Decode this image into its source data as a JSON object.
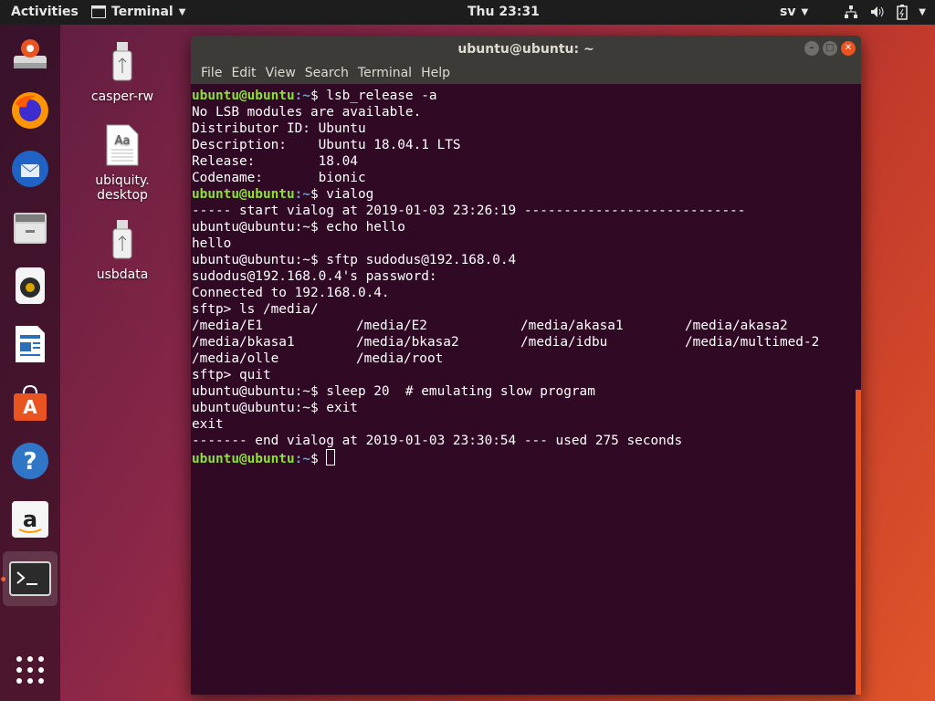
{
  "topbar": {
    "activities": "Activities",
    "app_menu": "Terminal",
    "clock": "Thu 23:31",
    "language": "sv"
  },
  "desktop": {
    "icons": [
      {
        "label": "casper-rw",
        "icon": "usb-drive-icon"
      },
      {
        "label": "ubiquity.\ndesktop",
        "icon": "text-file-icon"
      },
      {
        "label": "usbdata",
        "icon": "usb-drive-icon"
      }
    ]
  },
  "dock": {
    "items": [
      "installer-icon",
      "firefox-icon",
      "thunderbird-icon",
      "files-icon",
      "rhythmbox-icon",
      "writer-icon",
      "software-icon",
      "help-icon",
      "amazon-icon",
      "terminal-icon",
      "show-apps-icon"
    ]
  },
  "window": {
    "title": "ubuntu@ubuntu: ~",
    "menu": [
      "File",
      "Edit",
      "View",
      "Search",
      "Terminal",
      "Help"
    ]
  },
  "terminal": {
    "user": "ubuntu@ubuntu",
    "path": ":~",
    "lines": [
      {
        "p": "color",
        "cmd": "$ lsb_release -a"
      },
      {
        "t": "No LSB modules are available."
      },
      {
        "t": "Distributor ID: Ubuntu"
      },
      {
        "t": "Description:    Ubuntu 18.04.1 LTS"
      },
      {
        "t": "Release:        18.04"
      },
      {
        "t": "Codename:       bionic"
      },
      {
        "p": "color",
        "cmd": "$ vialog"
      },
      {
        "t": "----- start vialog at 2019-01-03 23:26:19 ----------------------------"
      },
      {
        "t": "ubuntu@ubuntu:~$ echo hello"
      },
      {
        "t": "hello"
      },
      {
        "t": "ubuntu@ubuntu:~$ sftp sudodus@192.168.0.4"
      },
      {
        "t": "sudodus@192.168.0.4's password:"
      },
      {
        "t": "Connected to 192.168.0.4."
      },
      {
        "t": "sftp> ls /media/"
      },
      {
        "cols": [
          "/media/E1",
          "/media/E2",
          "/media/akasa1",
          "/media/akasa2"
        ]
      },
      {
        "cols": [
          "/media/bkasa1",
          "/media/bkasa2",
          "/media/idbu",
          "/media/multimed-2"
        ]
      },
      {
        "cols": [
          "/media/olle",
          "/media/root"
        ]
      },
      {
        "t": "sftp> quit"
      },
      {
        "t": "ubuntu@ubuntu:~$ sleep 20  # emulating slow program"
      },
      {
        "t": "ubuntu@ubuntu:~$ exit"
      },
      {
        "t": "exit"
      },
      {
        "t": "------- end vialog at 2019-01-03 23:30:54 --- used 275 seconds"
      },
      {
        "p": "color",
        "cmd": "$ ",
        "cursor": true
      }
    ]
  }
}
